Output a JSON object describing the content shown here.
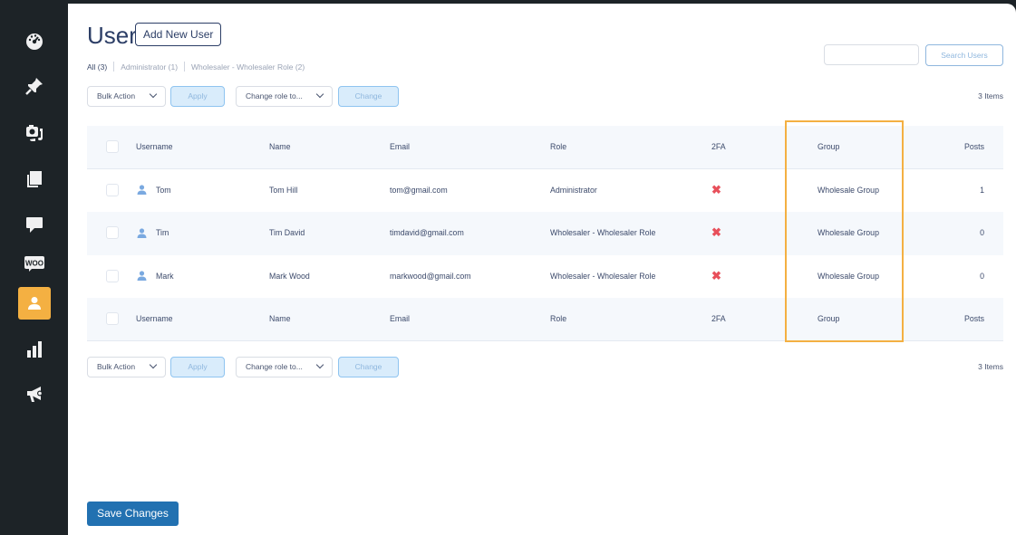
{
  "sidebar": {
    "items": [
      {
        "icon": "dashboard-icon"
      },
      {
        "icon": "pin-icon"
      },
      {
        "icon": "media-icon"
      },
      {
        "icon": "pages-icon"
      },
      {
        "icon": "comments-icon"
      },
      {
        "icon": "woo-icon",
        "label": "WOO"
      },
      {
        "icon": "users-icon",
        "active": true
      },
      {
        "icon": "analytics-icon"
      },
      {
        "icon": "marketing-icon"
      }
    ],
    "active_color": "#f4b042"
  },
  "page": {
    "title": "User",
    "add_new_label": "Add New User"
  },
  "filters": {
    "all": "All (3)",
    "administrator": "Administrator (1)",
    "wholesaler": "Wholesaler - Wholesaler Role (2)"
  },
  "search": {
    "placeholder": "",
    "button_label": "Search Users"
  },
  "bulk_top": {
    "bulk_action": "Bulk Action",
    "apply": "Apply",
    "change_role": "Change role to...",
    "change": "Change",
    "items_count": "3 Items"
  },
  "bulk_bottom": {
    "bulk_action": "Bulk Action",
    "apply": "Apply",
    "change_role": "Change role to...",
    "change": "Change",
    "items_count": "3 Items"
  },
  "table": {
    "columns": {
      "username": "Username",
      "name": "Name",
      "email": "Email",
      "role": "Role",
      "twofa": "2FA",
      "group": "Group",
      "posts": "Posts"
    },
    "rows": [
      {
        "username": "Tom",
        "name": "Tom Hill",
        "email": "tom@gmail.com",
        "role": "Administrator",
        "twofa": "✖",
        "group": "Wholesale Group",
        "posts": "1"
      },
      {
        "username": "Tim",
        "name": "Tim David",
        "email": "timdavid@gmail.com",
        "role": "Wholesaler - Wholesaler Role",
        "twofa": "✖",
        "group": "Wholesale Group",
        "posts": "0"
      },
      {
        "username": "Mark",
        "name": "Mark Wood",
        "email": "markwood@gmail.com",
        "role": "Wholesaler - Wholesaler Role",
        "twofa": "✖",
        "group": "Wholesale Group",
        "posts": "0"
      }
    ]
  },
  "save_label": "Save Changes",
  "colors": {
    "accent": "#2271b1",
    "highlight": "#f4b042",
    "twofa_off": "#e8505b"
  }
}
